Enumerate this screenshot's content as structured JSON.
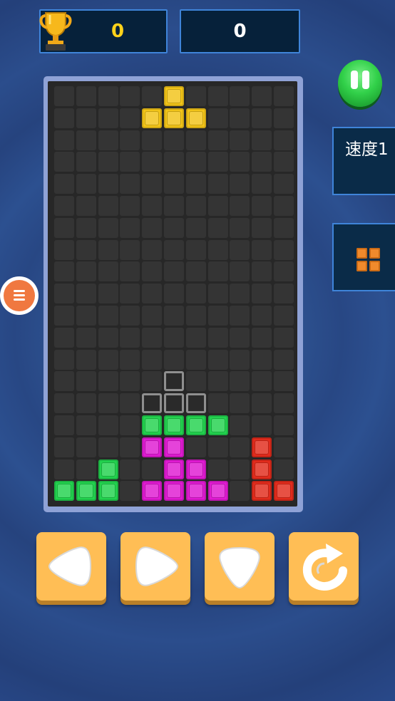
{
  "header": {
    "best_score": "0",
    "current_score": "0",
    "trophy_icon": "trophy-icon"
  },
  "side": {
    "speed_label": "速度1",
    "pause_icon": "pause-icon",
    "menu_icon": "hamburger-menu-icon",
    "next_piece": "O",
    "next_piece_color": "#f08a2c"
  },
  "board": {
    "cols": 11,
    "rows": 19,
    "colors": {
      "Y": "#f2c418",
      "G": "#22d24e",
      "M": "#e01ad2",
      "R": "#e22b1c"
    },
    "blocks": [
      {
        "c": 5,
        "r": 0,
        "t": "Y"
      },
      {
        "c": 4,
        "r": 1,
        "t": "Y"
      },
      {
        "c": 5,
        "r": 1,
        "t": "Y"
      },
      {
        "c": 6,
        "r": 1,
        "t": "Y"
      },
      {
        "c": 5,
        "r": 13,
        "t": "ghost"
      },
      {
        "c": 4,
        "r": 14,
        "t": "ghost"
      },
      {
        "c": 5,
        "r": 14,
        "t": "ghost"
      },
      {
        "c": 6,
        "r": 14,
        "t": "ghost"
      },
      {
        "c": 4,
        "r": 15,
        "t": "G"
      },
      {
        "c": 5,
        "r": 15,
        "t": "G"
      },
      {
        "c": 6,
        "r": 15,
        "t": "G"
      },
      {
        "c": 7,
        "r": 15,
        "t": "G"
      },
      {
        "c": 4,
        "r": 16,
        "t": "M"
      },
      {
        "c": 5,
        "r": 16,
        "t": "M"
      },
      {
        "c": 9,
        "r": 16,
        "t": "R"
      },
      {
        "c": 2,
        "r": 17,
        "t": "G"
      },
      {
        "c": 5,
        "r": 17,
        "t": "M"
      },
      {
        "c": 6,
        "r": 17,
        "t": "M"
      },
      {
        "c": 9,
        "r": 17,
        "t": "R"
      },
      {
        "c": 0,
        "r": 18,
        "t": "G"
      },
      {
        "c": 1,
        "r": 18,
        "t": "G"
      },
      {
        "c": 2,
        "r": 18,
        "t": "G"
      },
      {
        "c": 4,
        "r": 18,
        "t": "M"
      },
      {
        "c": 5,
        "r": 18,
        "t": "M"
      },
      {
        "c": 6,
        "r": 18,
        "t": "M"
      },
      {
        "c": 7,
        "r": 18,
        "t": "M"
      },
      {
        "c": 9,
        "r": 18,
        "t": "R"
      },
      {
        "c": 10,
        "r": 18,
        "t": "R"
      }
    ]
  },
  "controls": [
    {
      "name": "move-left-button",
      "icon": "left-arrow-icon"
    },
    {
      "name": "move-right-button",
      "icon": "right-arrow-icon"
    },
    {
      "name": "drop-down-button",
      "icon": "down-arrow-icon"
    },
    {
      "name": "rotate-button",
      "icon": "rotate-icon"
    }
  ]
}
